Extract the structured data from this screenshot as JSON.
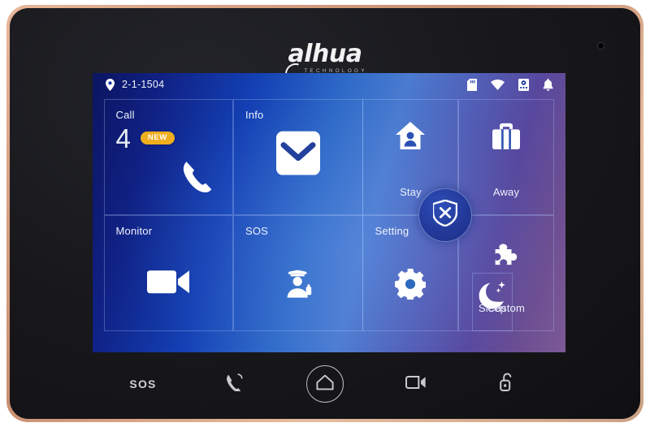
{
  "device": {
    "brand": "alhua",
    "brand_sub": "TECHNOLOGY",
    "frame_color": "#d9a284",
    "bezel_color": "#19191d",
    "sensor_name": "ambient-light-sensor"
  },
  "screen": {
    "background_gradient_from": "#0c1560",
    "background_gradient_mid": "#4a7bd0",
    "background_gradient_to": "#7d5a96",
    "statusbar": {
      "location_icon": "location-pin-icon",
      "address": "2-1-1504",
      "icons": [
        {
          "name": "sd-card-icon",
          "label": "SD Card"
        },
        {
          "name": "wifi-icon",
          "label": "Wi-Fi"
        },
        {
          "name": "alarm-device-icon",
          "label": "Alarm Device"
        },
        {
          "name": "bell-icon",
          "label": "Notifications"
        }
      ]
    },
    "tiles": {
      "call": {
        "label": "Call",
        "count": "4",
        "badge": "NEW",
        "badge_color": "#efaf1e",
        "icon": "phone-handset-icon"
      },
      "info": {
        "label": "Info",
        "icon": "envelope-icon"
      },
      "stay": {
        "label": "Stay",
        "icon": "home-person-icon"
      },
      "away": {
        "label": "Away",
        "icon": "briefcase-icon"
      },
      "monitor": {
        "label": "Monitor",
        "icon": "video-camera-icon"
      },
      "sos": {
        "label": "SOS",
        "icon": "security-guard-icon"
      },
      "setting": {
        "label": "Setting",
        "icon": "gear-icon"
      },
      "sleep": {
        "label": "Sleep",
        "icon": "crescent-moon-icon"
      },
      "custom": {
        "label": "Custom",
        "icon": "puzzle-piece-icon"
      }
    },
    "center_button": {
      "name": "disarm-shield-button",
      "icon": "shield-x-icon"
    }
  },
  "hardware_buttons": [
    {
      "name": "sos-button",
      "label": "SOS",
      "icon": "text-sos"
    },
    {
      "name": "call-button",
      "label": "",
      "icon": "phone-call-icon"
    },
    {
      "name": "home-button",
      "label": "",
      "icon": "home-icon"
    },
    {
      "name": "monitor-button",
      "label": "",
      "icon": "camera-icon"
    },
    {
      "name": "unlock-button",
      "label": "",
      "icon": "unlock-icon"
    }
  ]
}
